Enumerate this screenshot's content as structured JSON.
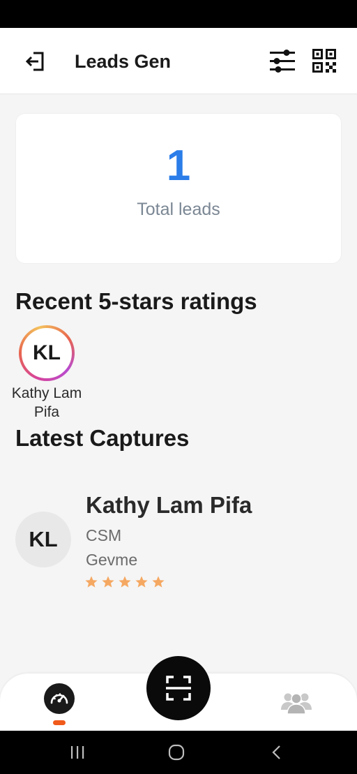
{
  "header": {
    "title": "Leads Gen",
    "logout_icon": "logout-icon",
    "filter_icon": "sliders-icon",
    "qr_icon": "qr-code-icon"
  },
  "summary": {
    "total_value": "1",
    "total_label": "Total leads"
  },
  "recent_ratings": {
    "title": "Recent 5-stars ratings",
    "items": [
      {
        "initials": "KL",
        "name": "Kathy Lam Pifa"
      }
    ]
  },
  "latest_captures": {
    "title": "Latest Captures",
    "items": [
      {
        "initials": "KL",
        "name": "Kathy Lam Pifa",
        "role": "CSM",
        "company": "Gevme",
        "rating": 5,
        "rating_max": 5
      }
    ]
  },
  "bottom_nav": {
    "items": [
      {
        "icon": "dashboard-gauge-icon",
        "active": true
      },
      {
        "icon": "scan-icon"
      },
      {
        "icon": "team-icon"
      }
    ]
  },
  "colors": {
    "accent_blue": "#2b7de9",
    "star": "#f5a862",
    "active_indicator": "#f05a1a"
  }
}
